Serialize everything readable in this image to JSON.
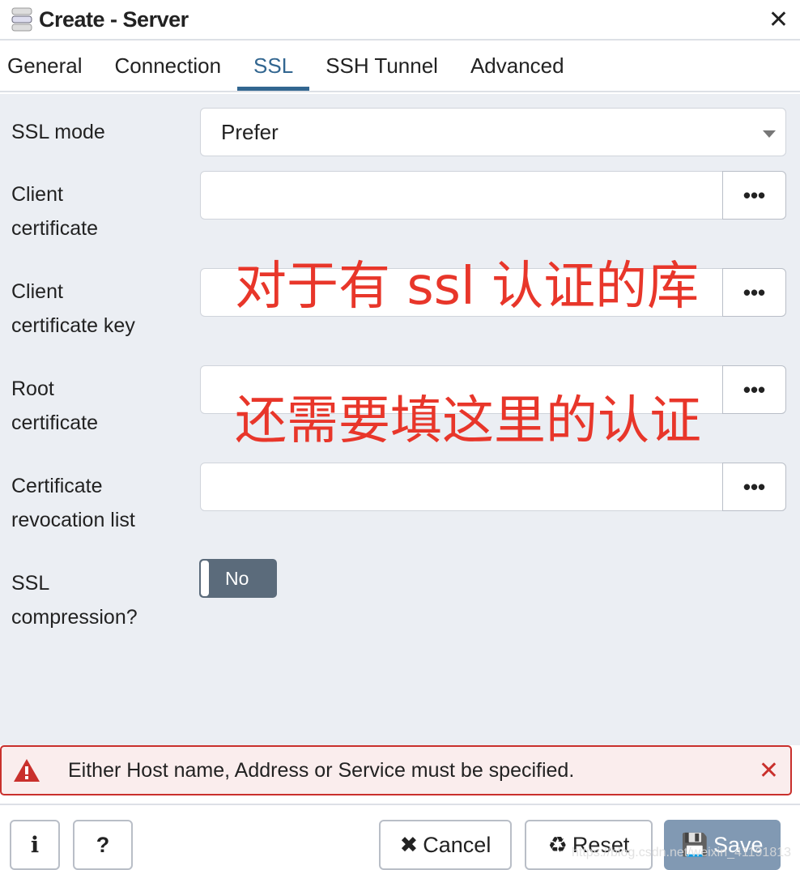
{
  "title": "Create - Server",
  "tabs": [
    "General",
    "Connection",
    "SSL",
    "SSH Tunnel",
    "Advanced"
  ],
  "active_tab": "SSL",
  "fields": {
    "ssl_mode": {
      "label": "SSL mode",
      "value": "Prefer"
    },
    "client_cert": {
      "label1": "Client",
      "label2": "certificate",
      "value": ""
    },
    "client_key": {
      "label1": "Client",
      "label2": "certificate key",
      "value": ""
    },
    "root_cert": {
      "label1": "Root",
      "label2": "certificate",
      "value": ""
    },
    "crl": {
      "label1": "Certificate",
      "label2": "revocation list",
      "value": ""
    },
    "ssl_compression": {
      "label1": "SSL",
      "label2": "compression?",
      "value": "No"
    }
  },
  "browse_label": "•••",
  "alert": {
    "message": "Either Host name, Address or Service must be specified."
  },
  "footer": {
    "info": "i",
    "help": "?",
    "cancel": "Cancel",
    "reset": "Reset",
    "save": "Save"
  },
  "annotations": [
    "对于有 ssl 认证的库",
    "还需要填这里的认证"
  ],
  "watermark": "https://blog.csdn.net/weixin_41191813",
  "colors": {
    "accent": "#326690",
    "error": "#c9302c",
    "annotation": "#e8362a",
    "save": "#8199b3"
  }
}
